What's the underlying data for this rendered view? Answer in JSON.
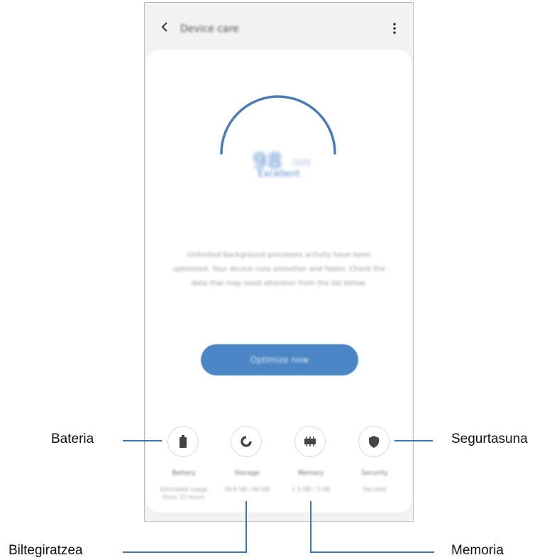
{
  "screen": {
    "title": "Device care",
    "score": "98",
    "score_unit": "/100",
    "status": "Excellent",
    "description": "Unlimited background processes activity have been optimized. Your device runs smoother and faster. Check the data that may need attention from the list below.",
    "optimize_label": "Optimize now"
  },
  "tiles": [
    {
      "name": "Battery",
      "sub": "Estimated usage time: 12 hours"
    },
    {
      "name": "Storage",
      "sub": "29.8 GB / 64 GB"
    },
    {
      "name": "Memory",
      "sub": "1.3 GB / 3 GB"
    },
    {
      "name": "Security",
      "sub": "Secured"
    }
  ],
  "callouts": {
    "battery": "Bateria",
    "storage": "Biltegiratzea",
    "memory": "Memoria",
    "security": "Segurtasuna"
  },
  "colors": {
    "accent": "#4a86c5",
    "gauge": "#4a7bb8",
    "line": "#3a78b5"
  },
  "icons": [
    "back-arrow-icon",
    "more-vertical-icon",
    "battery-icon",
    "storage-icon",
    "memory-icon",
    "shield-icon"
  ]
}
